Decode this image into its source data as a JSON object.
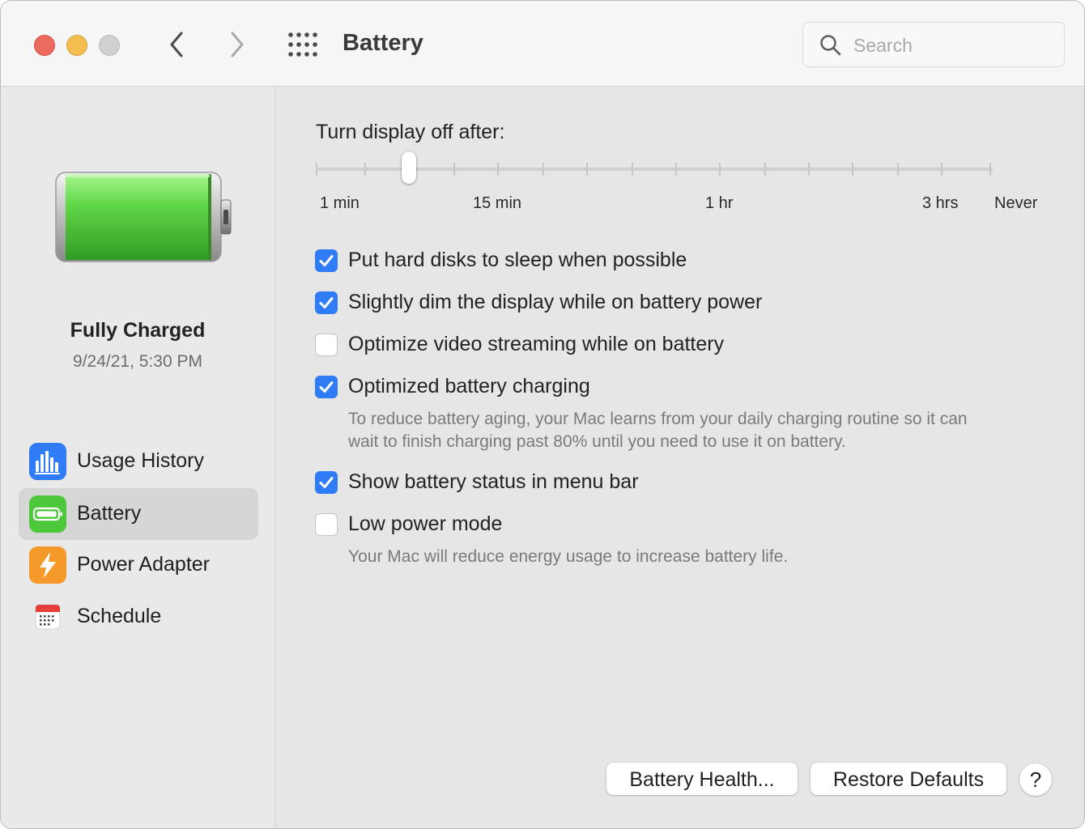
{
  "window": {
    "title": "Battery",
    "search": {
      "placeholder": "Search",
      "value": ""
    }
  },
  "sidebar": {
    "status_title": "Fully Charged",
    "status_date": "9/24/21, 5:30 PM",
    "battery_level": 1.0,
    "items": [
      {
        "label": "Usage History",
        "icon": "usage-history-icon",
        "selected": false
      },
      {
        "label": "Battery",
        "icon": "battery-icon",
        "selected": true
      },
      {
        "label": "Power Adapter",
        "icon": "power-adapter-icon",
        "selected": false
      },
      {
        "label": "Schedule",
        "icon": "schedule-icon",
        "selected": false
      }
    ]
  },
  "display_off": {
    "label": "Turn display off after:",
    "tick_labels": [
      "1 min",
      "15 min",
      "1 hr",
      "3 hrs",
      "Never"
    ],
    "selected_tick_index": 2,
    "tick_count": 16
  },
  "options": [
    {
      "label": "Put hard disks to sleep when possible",
      "checked": true
    },
    {
      "label": "Slightly dim the display while on battery power",
      "checked": true
    },
    {
      "label": "Optimize video streaming while on battery",
      "checked": false
    },
    {
      "label": "Optimized battery charging",
      "checked": true,
      "help_lines": [
        "To reduce battery aging, your Mac learns from your daily charging routine so it can",
        "wait to finish charging past 80% until you need to use it on battery."
      ]
    },
    {
      "label": "Show battery status in menu bar",
      "checked": true
    },
    {
      "label": "Low power mode",
      "checked": false,
      "help_lines": [
        "Your Mac will reduce energy usage to increase battery life."
      ]
    }
  ],
  "buttons": {
    "battery_health": "Battery Health...",
    "restore_defaults": "Restore Defaults",
    "help": "?"
  },
  "colors": {
    "accent": "#2f7cf6",
    "battery_green": "#4cc83a",
    "close": "#ed6a5e",
    "minimize": "#f5bf4f",
    "zoom": "#d0d0d0"
  }
}
